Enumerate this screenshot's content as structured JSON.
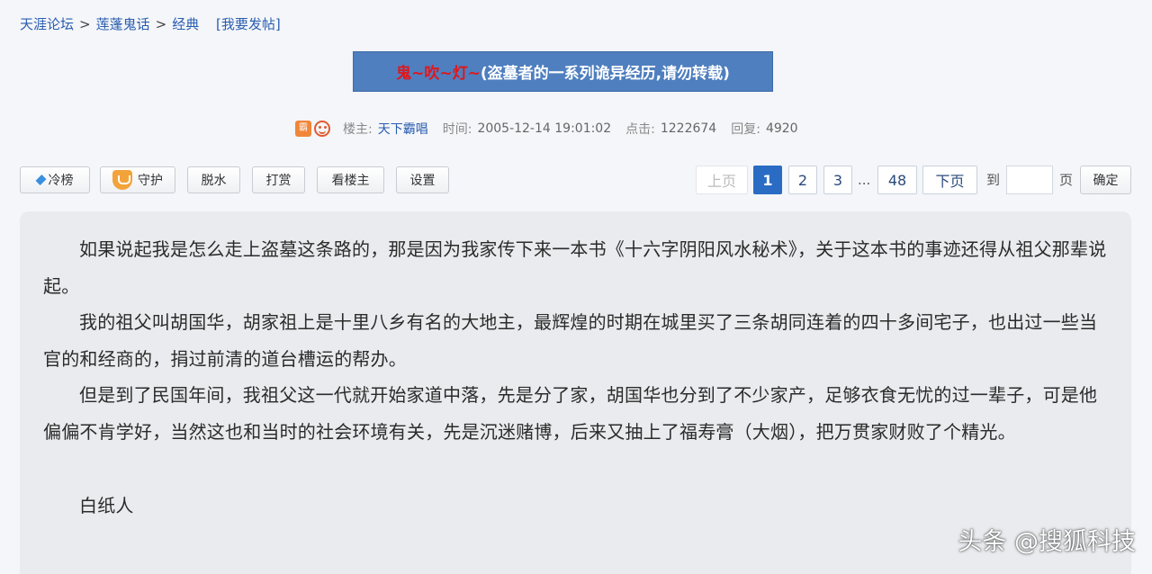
{
  "breadcrumb": {
    "items": [
      "天涯论坛",
      "莲蓬鬼话",
      "经典"
    ],
    "separator": ">",
    "post_link": "[我要发帖]"
  },
  "thread": {
    "title_highlight": "鬼~吹~灯~",
    "title_rest": "(盗墓者的一系列诡异经历,请勿转载)",
    "banner_color": "#4f7fbf",
    "highlight_color": "#e0161c"
  },
  "meta": {
    "author_label": "楼主:",
    "author": "天下霸唱",
    "time_label": "时间:",
    "time": "2005-12-14 19:01:02",
    "clicks_label": "点击:",
    "clicks": "1222674",
    "replies_label": "回复:",
    "replies": "4920",
    "avatar_icon": "level-badge-icon",
    "mood_icon": "smiley-icon"
  },
  "toolbar": {
    "buttons": [
      "冷榜",
      "守护",
      "脱水",
      "打赏",
      "看楼主",
      "设置"
    ]
  },
  "pager": {
    "prev": "上页",
    "pages": [
      "1",
      "2",
      "3"
    ],
    "ellipsis": "...",
    "last": "48",
    "next": "下页",
    "goto_label": "到",
    "page_unit": "页",
    "page_input_value": "",
    "confirm": "确定",
    "current_page": "1",
    "accent_color": "#2a6cc4"
  },
  "content": {
    "paragraphs": [
      "如果说起我是怎么走上盗墓这条路的，那是因为我家传下来一本书《十六字阴阳风水秘术》，关于这本书的事迹还得从祖父那辈说起。",
      "我的祖父叫胡国华，胡家祖上是十里八乡有名的大地主，最辉煌的时期在城里买了三条胡同连着的四十多间宅子，也出过一些当官的和经商的，捐过前清的道台槽运的帮办。",
      "但是到了民国年间，我祖父这一代就开始家道中落，先是分了家，胡国华也分到了不少家产，足够衣食无忧的过一辈子，可是他偏偏不肯学好，当然这也和当时的社会环境有关，先是沉迷赌博，后来又抽上了福寿膏（大烟），把万贯家财败了个精光。"
    ],
    "section_title": "白纸人"
  },
  "watermark": "头条 @搜狐科技"
}
